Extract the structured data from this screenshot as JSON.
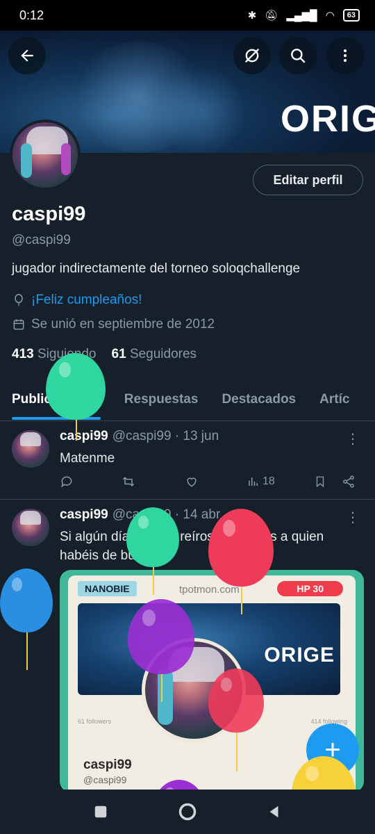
{
  "status_bar": {
    "time": "0:12",
    "battery": "63"
  },
  "header": {
    "banner_logo": "ORIG",
    "icons": [
      "back-arrow-icon",
      "grok-icon",
      "search-icon",
      "more-vertical-icon"
    ]
  },
  "profile": {
    "edit_label": "Editar perfil",
    "name": "caspi99",
    "handle": "@caspi99",
    "bio": "jugador indirectamente del torneo soloqchallenge",
    "birthday": "¡Feliz cumpleaños!",
    "joined": "Se unió en septiembre de 2012",
    "following_count": "413",
    "following_label": "Siguiendo",
    "followers_count": "61",
    "followers_label": "Seguidores"
  },
  "tabs": [
    {
      "label": "Publicaciones",
      "active": true
    },
    {
      "label": "Respuestas",
      "active": false
    },
    {
      "label": "Destacados",
      "active": false
    },
    {
      "label": "Artíc",
      "active": false
    }
  ],
  "posts": [
    {
      "name": "caspi99",
      "meta": "@caspi99 · 13 jun",
      "text": "Matenme",
      "views": "18"
    },
    {
      "name": "caspi99",
      "meta": "@caspi99 · 14 abr",
      "text": "Si algún día queréis reíros, ya sabéis a quien habéis de buscar",
      "card": {
        "tag_left": "NANOBIE",
        "site": "tpotmon.com",
        "hp": "HP 30",
        "logo": "ORIGE",
        "followers": "61 followers",
        "following": "414 following",
        "name": "caspi99",
        "handle": "@caspi99"
      }
    }
  ],
  "colors": {
    "background": "#15202b",
    "accent": "#1d9bf0",
    "muted": "#8b98a5",
    "balloon_green": "#2fd6a0",
    "balloon_red": "#ef3b5a",
    "balloon_blue": "#2a8fe0",
    "balloon_purple": "#9b2fd3",
    "balloon_yellow": "#f7d13a"
  }
}
